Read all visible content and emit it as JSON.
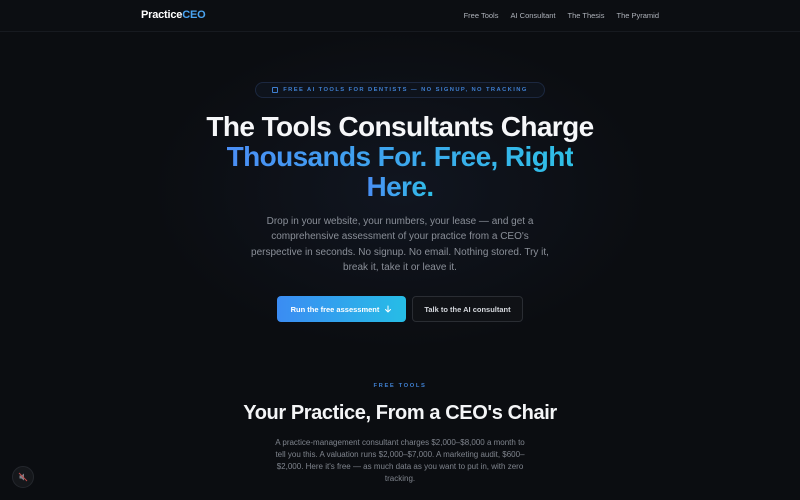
{
  "nav": {
    "logo_primary": "Practice",
    "logo_accent": "CEO",
    "links": [
      "Free Tools",
      "AI Consultant",
      "The Thesis",
      "The Pyramid"
    ]
  },
  "hero": {
    "badge": "FREE AI TOOLS FOR DENTISTS — NO SIGNUP, NO TRACKING",
    "title_line1": "The Tools Consultants Charge",
    "title_line2": "Thousands For. Free, Right",
    "title_line3": "Here.",
    "lead": "Drop in your website, your numbers, your lease — and get a comprehensive assessment of your practice from a CEO's perspective in seconds. No signup. No email. Nothing stored. Try it, break it, take it or leave it.",
    "primary_button": "Run the free assessment",
    "secondary_button": "Talk to the AI consultant"
  },
  "section": {
    "eyebrow": "FREE TOOLS",
    "title": "Your Practice, From a CEO's Chair",
    "body": "A practice-management consultant charges $2,000–$8,000 a month to tell you this. A valuation runs $2,000–$7,000. A marketing audit, $600–$2,000. Here it's free — as much data as you want to put in, with zero tracking."
  },
  "icons": {
    "badge_icon": "box-icon",
    "primary_button_icon": "arrow-down-icon",
    "floating_button_icon": "mute-icon"
  },
  "colors": {
    "background": "#0b0d11",
    "accent": "#3f7fd0",
    "gradient_start": "#3b8cf3",
    "gradient_end": "#26bde6"
  }
}
